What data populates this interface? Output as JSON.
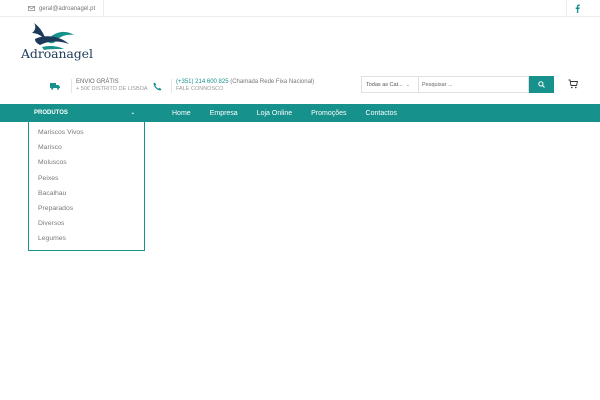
{
  "topbar": {
    "email": "geral@adroanagel.pt",
    "social_icon": "facebook-icon"
  },
  "brand": {
    "name": "Adroanagel"
  },
  "shipping": {
    "title": "ENVIO GRÁTIS",
    "subtitle": "+ 50€ DISTRITO DE LISBOA",
    "icon": "truck-icon"
  },
  "contact": {
    "phone": "(+351) 214 600 825",
    "phone_note": "(Chamada Rede Fixa Nacional)",
    "subtitle": "FALE CONNOSCO",
    "icon": "phone-icon"
  },
  "search": {
    "category_label": "Todas as Cat...",
    "placeholder": "Pesquisar ..."
  },
  "nav": {
    "products_label": "PRODUTOS",
    "links": [
      "Home",
      "Empresa",
      "Loja Online",
      "Promoções",
      "Contactos"
    ]
  },
  "categories": [
    "Mariscos Vivos",
    "Marisco",
    "Moluscos",
    "Peixes",
    "Bacalhau",
    "Preparados",
    "Diversos",
    "Legumes"
  ],
  "colors": {
    "accent": "#16918b",
    "brand_navy": "#1e3a5a"
  }
}
